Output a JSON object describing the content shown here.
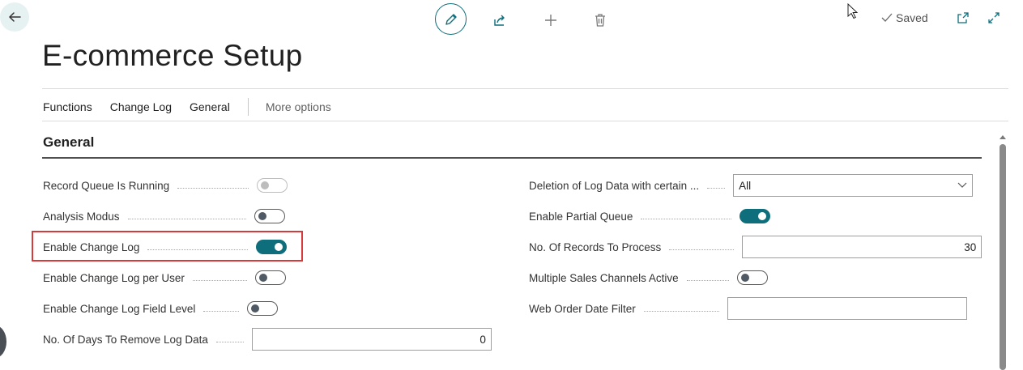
{
  "header": {
    "title": "E-commerce Setup",
    "saved_label": "Saved"
  },
  "menu": {
    "items": [
      "Functions",
      "Change Log",
      "General"
    ],
    "more_label": "More options"
  },
  "section": {
    "title": "General"
  },
  "left_fields": [
    {
      "label": "Record Queue Is Running",
      "type": "toggle",
      "state": "off-disabled"
    },
    {
      "label": "Analysis Modus",
      "type": "toggle",
      "state": "off"
    },
    {
      "label": "Enable Change Log",
      "type": "toggle",
      "state": "on"
    },
    {
      "label": "Enable Change Log per User",
      "type": "toggle",
      "state": "off"
    },
    {
      "label": "Enable Change Log Field Level",
      "type": "toggle",
      "state": "off"
    },
    {
      "label": "No. Of Days To Remove Log Data",
      "type": "number",
      "value": "0"
    }
  ],
  "right_fields": [
    {
      "label": "Deletion of Log Data with certain ...",
      "type": "select",
      "value": "All"
    },
    {
      "label": "Enable Partial Queue",
      "type": "toggle",
      "state": "on"
    },
    {
      "label": "No. Of Records To Process",
      "type": "number",
      "value": "30"
    },
    {
      "label": "Multiple Sales Channels Active",
      "type": "toggle",
      "state": "off"
    },
    {
      "label": "Web Order Date Filter",
      "type": "text",
      "value": ""
    }
  ],
  "colors": {
    "accent": "#0f6e7b",
    "highlight": "#d63a3a"
  },
  "icons": [
    "back-arrow-icon",
    "pencil-icon",
    "share-icon",
    "plus-icon",
    "trash-icon",
    "checkmark-icon",
    "open-new-window-icon",
    "expand-icon",
    "mouse-cursor-icon",
    "chevron-down-icon"
  ]
}
